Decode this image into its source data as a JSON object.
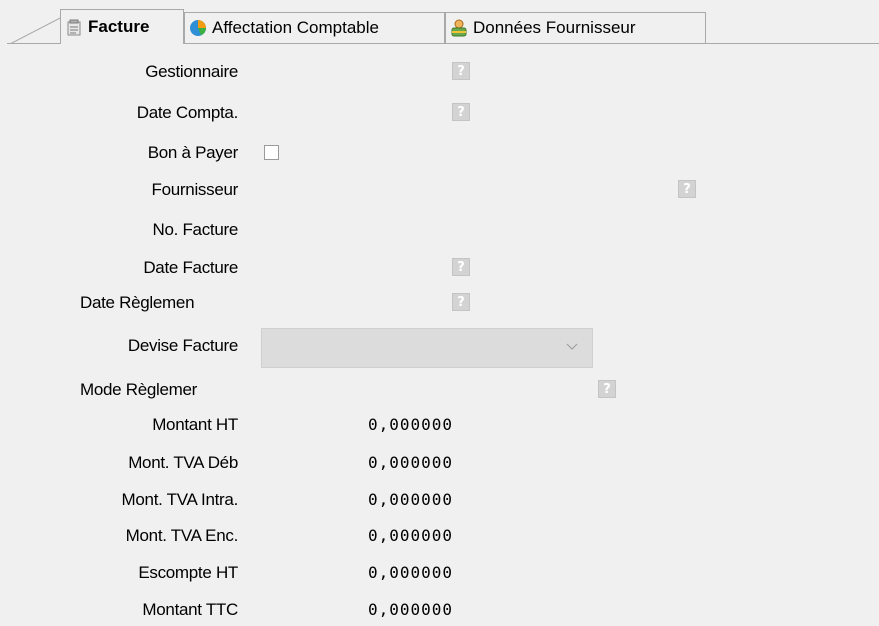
{
  "tabs": [
    {
      "label": "Facture",
      "icon": "invoice-icon",
      "active": true
    },
    {
      "label": "Affectation Comptable",
      "icon": "pie-chart-icon",
      "active": false
    },
    {
      "label": "Données Fournisseur",
      "icon": "supplier-icon",
      "active": false
    }
  ],
  "form": {
    "help_glyph": "?",
    "gestionnaire_label": "Gestionnaire",
    "date_compta_label": "Date Compta.",
    "bon_a_payer_label": "Bon à Payer",
    "bon_a_payer_checked": false,
    "fournisseur_label": "Fournisseur",
    "no_facture_label": "No. Facture",
    "date_facture_label": "Date Facture",
    "date_reglement_label": "Date Règlemen",
    "devise_facture_label": "Devise Facture",
    "devise_facture_value": "",
    "mode_reglement_label": "Mode Règlemer",
    "montant_ht_label": "Montant HT",
    "montant_ht_value": "0,000000",
    "mont_tva_deb_label": "Mont. TVA Déb",
    "mont_tva_deb_value": "0,000000",
    "mont_tva_intra_label": "Mont. TVA Intra.",
    "mont_tva_intra_value": "0,000000",
    "mont_tva_enc_label": "Mont. TVA Enc.",
    "mont_tva_enc_value": "0,000000",
    "escompte_ht_label": "Escompte HT",
    "escompte_ht_value": "0,000000",
    "montant_ttc_label": "Montant TTC",
    "montant_ttc_value": "0,000000"
  },
  "colors": {
    "background": "#f0f0f0",
    "help_button": "#d3d3d3",
    "disabled_combo": "#dcdcdc",
    "tab_border": "#a9a9a9"
  }
}
